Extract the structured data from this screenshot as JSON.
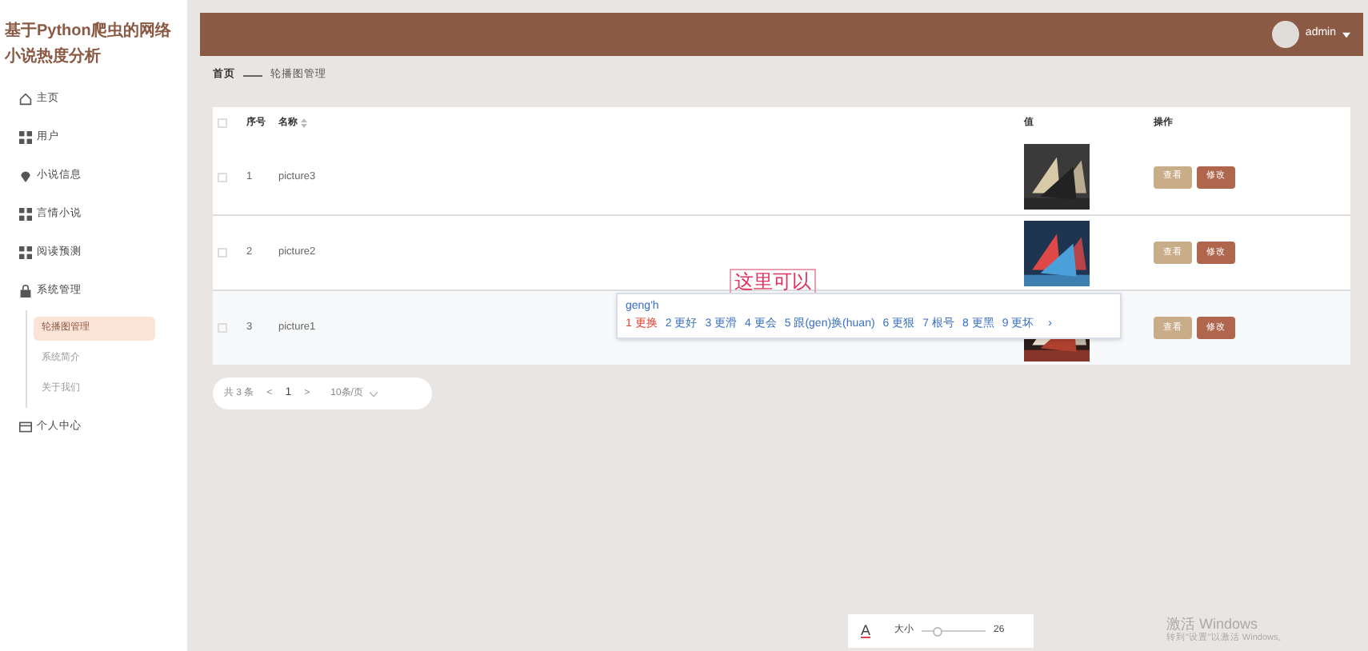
{
  "sidebar": {
    "title": "基于Python爬虫的网络小说热度分析",
    "items": [
      {
        "label": "主页",
        "kind": "home",
        "selected": false
      },
      {
        "label": "用户",
        "kind": "grid",
        "selected": false
      },
      {
        "label": "小说信息",
        "kind": "pin",
        "selected": false
      },
      {
        "label": "言情小说",
        "kind": "grid",
        "selected": false
      },
      {
        "label": "阅读预测",
        "kind": "grid",
        "selected": false
      },
      {
        "label": "系统管理",
        "kind": "lock",
        "selected": false,
        "children": [
          {
            "label": "轮播图管理",
            "selected": true
          },
          {
            "label": "系统简介",
            "selected": false
          },
          {
            "label": "关于我们",
            "selected": false
          }
        ]
      },
      {
        "label": "个人中心",
        "kind": "card",
        "selected": false
      }
    ]
  },
  "header": {
    "user": "admin"
  },
  "breadcrumb": [
    "首页",
    "轮播图管理"
  ],
  "table": {
    "all_checked": false,
    "columns": [
      "序号",
      "名称",
      "值",
      "操作"
    ],
    "rows": [
      {
        "index": "1",
        "name": "picture3",
        "checked": false,
        "actions": [
          "查看",
          "修改"
        ]
      },
      {
        "index": "2",
        "name": "picture2",
        "checked": false,
        "actions": [
          "查看",
          "修改"
        ]
      },
      {
        "index": "3",
        "name": "picture1",
        "checked": false,
        "actions": [
          "查看",
          "修改"
        ]
      }
    ]
  },
  "pagination": {
    "total": "共 3 条",
    "prev": "<",
    "page": "1",
    "next": ">",
    "page_size": "10条/页"
  },
  "annotation": "这里可以",
  "ime": {
    "input": "geng'h",
    "candidates": [
      {
        "label": "1 更换",
        "selected": true
      },
      {
        "label": "2 更好",
        "selected": false
      },
      {
        "label": "3 更滑",
        "selected": false
      },
      {
        "label": "4 更会",
        "selected": false
      },
      {
        "label": "5 跟(gen)换(huan)",
        "selected": false
      },
      {
        "label": "6 更狠",
        "selected": false
      },
      {
        "label": "7 根号",
        "selected": false
      },
      {
        "label": "8 更黑",
        "selected": false
      },
      {
        "label": "9 更坏",
        "selected": false
      }
    ],
    "more": "›"
  },
  "toolbar": {
    "font_letter": "A",
    "size_label": "大小",
    "level": 0.25,
    "size_value": "26"
  },
  "os_notice": {
    "title": "激活 Windows",
    "subtitle": "转到\"设置\"以激活 Windows。"
  }
}
